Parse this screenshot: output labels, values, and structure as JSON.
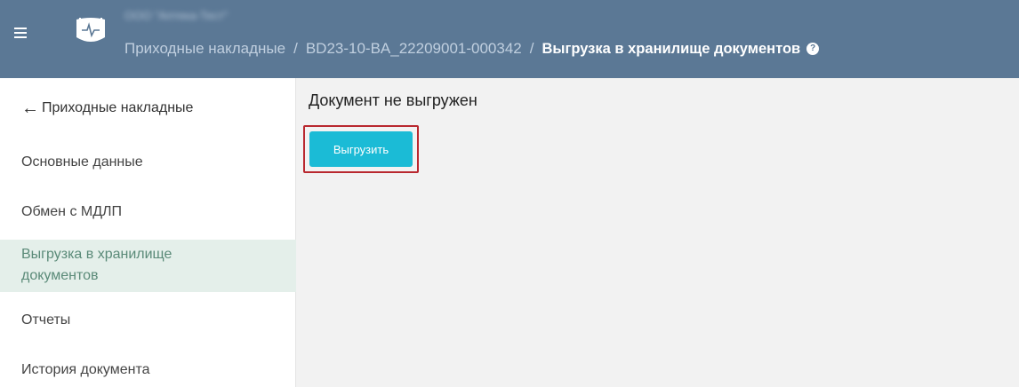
{
  "header": {
    "org_name": "ООО \"Аптека-Тест\"",
    "breadcrumb": {
      "root": "Приходные накладные",
      "separator": "/",
      "document": "BD23-10-BA_22209001-000342",
      "current": "Выгрузка в хранилище документов"
    },
    "help_icon": "?"
  },
  "sidebar": {
    "back_label": "Приходные накладные",
    "back_icon": "←",
    "items": [
      {
        "label": "Основные данные"
      },
      {
        "label": "Обмен с МДЛП"
      },
      {
        "label": "Выгрузка в хранилище документов",
        "active": true
      },
      {
        "label": "Отчеты"
      },
      {
        "label": "История документа"
      }
    ]
  },
  "main": {
    "status_text": "Документ не выгружен",
    "upload_button_label": "Выгрузить"
  },
  "colors": {
    "header_bg": "#5b7895",
    "active_item_bg": "#e4efea",
    "upload_button": "#1bbbd6",
    "highlight_border": "#b9282f"
  }
}
